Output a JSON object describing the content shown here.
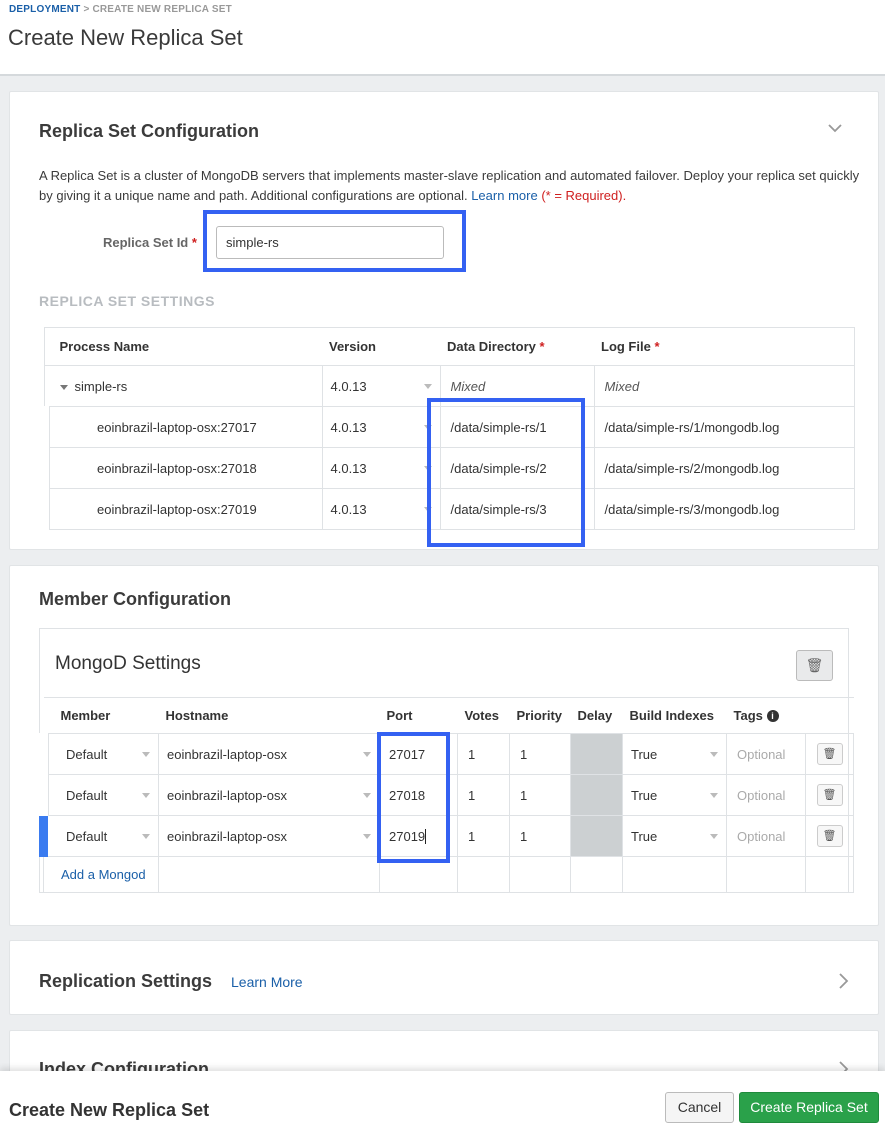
{
  "breadcrumb": {
    "parent": "DEPLOYMENT",
    "separator": ">",
    "current": "CREATE NEW REPLICA SET"
  },
  "page_title": "Create New Replica Set",
  "replica_config": {
    "title": "Replica Set Configuration",
    "desc_text": "A Replica Set is a cluster of MongoDB servers that implements master-slave replication and automated failover. Deploy your replica set quickly by giving it a unique name and path. Additional configurations are optional.",
    "learn_more": "Learn more",
    "required_note": "(* = Required).",
    "id_label": "Replica Set Id",
    "required_star": "*",
    "id_value": "simple-rs",
    "settings_heading": "REPLICA SET SETTINGS",
    "columns": {
      "process": "Process Name",
      "version": "Version",
      "datadir": "Data Directory",
      "logfile": "Log File"
    },
    "group": {
      "name": "simple-rs",
      "version": "4.0.13",
      "datadir": "Mixed",
      "logfile": "Mixed"
    },
    "processes": [
      {
        "name": "eoinbrazil-laptop-osx:27017",
        "version": "4.0.13",
        "datadir": "/data/simple-rs/1",
        "logfile": "/data/simple-rs/1/mongodb.log"
      },
      {
        "name": "eoinbrazil-laptop-osx:27018",
        "version": "4.0.13",
        "datadir": "/data/simple-rs/2",
        "logfile": "/data/simple-rs/2/mongodb.log"
      },
      {
        "name": "eoinbrazil-laptop-osx:27019",
        "version": "4.0.13",
        "datadir": "/data/simple-rs/3",
        "logfile": "/data/simple-rs/3/mongodb.log"
      }
    ]
  },
  "member_config": {
    "title": "Member Configuration",
    "subtitle": "MongoD Settings",
    "columns": {
      "member": "Member",
      "hostname": "Hostname",
      "port": "Port",
      "votes": "Votes",
      "priority": "Priority",
      "delay": "Delay",
      "build_indexes": "Build Indexes",
      "tags": "Tags"
    },
    "members": [
      {
        "member": "Default",
        "hostname": "eoinbrazil-laptop-osx",
        "port": "27017",
        "votes": "1",
        "priority": "1",
        "build_indexes": "True",
        "tags_placeholder": "Optional"
      },
      {
        "member": "Default",
        "hostname": "eoinbrazil-laptop-osx",
        "port": "27018",
        "votes": "1",
        "priority": "1",
        "build_indexes": "True",
        "tags_placeholder": "Optional"
      },
      {
        "member": "Default",
        "hostname": "eoinbrazil-laptop-osx",
        "port": "27019",
        "votes": "1",
        "priority": "1",
        "build_indexes": "True",
        "tags_placeholder": "Optional"
      }
    ],
    "add_label": "Add a Mongod"
  },
  "replication_settings": {
    "title": "Replication Settings",
    "learn_more": "Learn More"
  },
  "index_config": {
    "title": "Index Configuration"
  },
  "footer": {
    "title": "Create New Replica Set",
    "cancel": "Cancel",
    "create": "Create Replica Set"
  },
  "colors": {
    "accent": "#3461f2",
    "primary_button": "#2aa14a",
    "link": "#1a5fa8",
    "required": "#cf1f1f"
  }
}
